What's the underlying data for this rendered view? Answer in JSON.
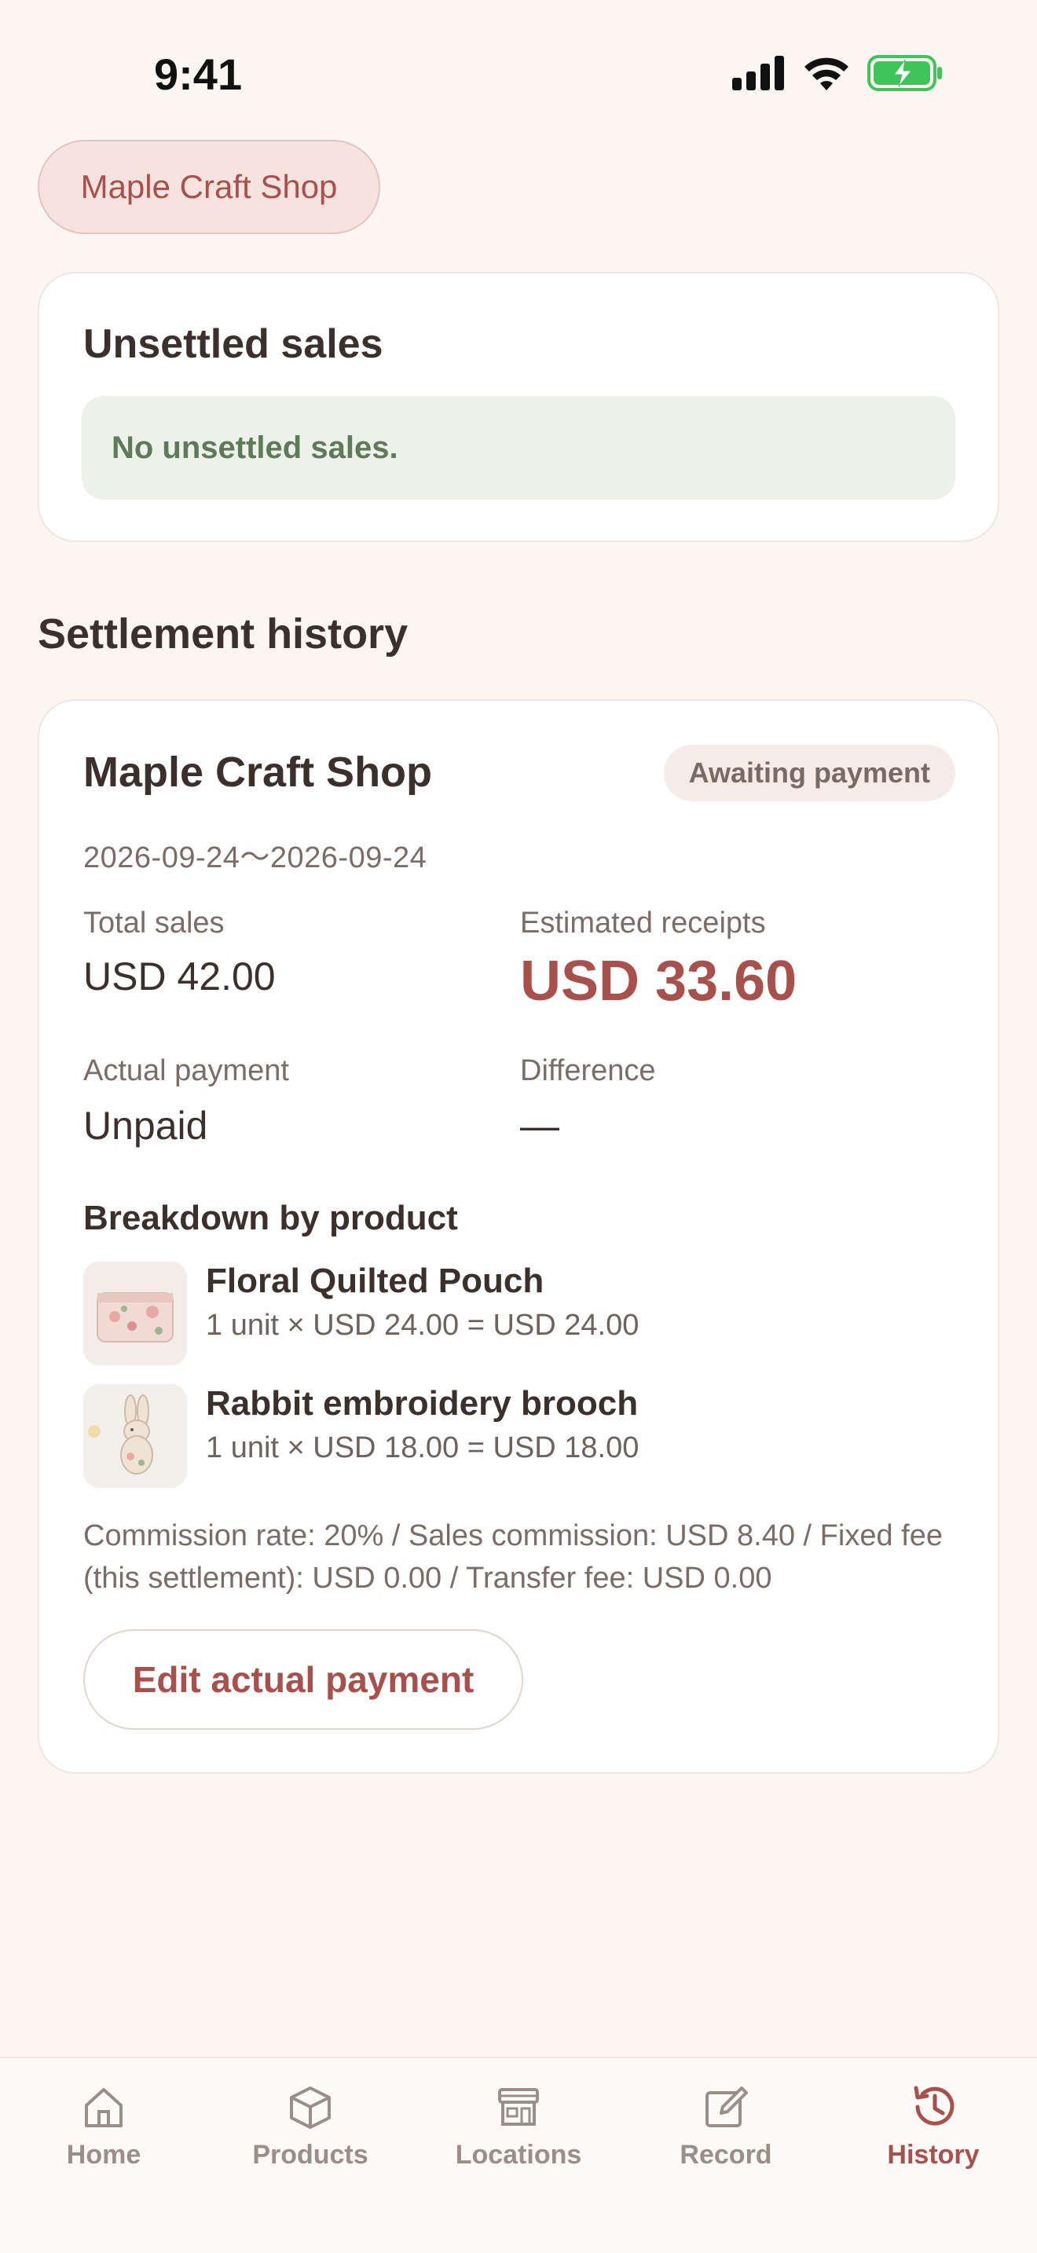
{
  "status_bar": {
    "time": "9:41",
    "icons": [
      "cellular-signal-icon",
      "wifi-icon",
      "battery-charging-icon"
    ]
  },
  "shop_filter": {
    "label": "Maple Craft Shop"
  },
  "unsettled": {
    "title": "Unsettled sales",
    "empty_message": "No unsettled sales."
  },
  "history": {
    "section_title": "Settlement history",
    "item": {
      "shop_name": "Maple Craft Shop",
      "status": "Awaiting payment",
      "period": "2026-09-24〜2026-09-24",
      "total_sales_label": "Total sales",
      "total_sales_value": "USD 42.00",
      "estimated_label": "Estimated receipts",
      "estimated_value": "USD 33.60",
      "actual_label": "Actual payment",
      "actual_value": "Unpaid",
      "difference_label": "Difference",
      "difference_value": "—",
      "breakdown_title": "Breakdown by product",
      "products": [
        {
          "name": "Floral Quilted Pouch",
          "detail": "1 unit × USD 24.00 = USD 24.00",
          "thumb": "floral-pouch-thumbnail"
        },
        {
          "name": "Rabbit embroidery brooch",
          "detail": "1 unit × USD 18.00 = USD 18.00",
          "thumb": "rabbit-brooch-thumbnail"
        }
      ],
      "commission_text": "Commission rate: 20% / Sales commission: USD 8.40 / Fixed fee (this settlement): USD 0.00 / Transfer fee: USD 0.00",
      "edit_button": "Edit actual payment"
    }
  },
  "tabs": [
    {
      "label": "Home",
      "icon": "home-icon",
      "active": false
    },
    {
      "label": "Products",
      "icon": "box-icon",
      "active": false
    },
    {
      "label": "Locations",
      "icon": "store-icon",
      "active": false
    },
    {
      "label": "Record",
      "icon": "edit-icon",
      "active": false
    },
    {
      "label": "History",
      "icon": "history-icon",
      "active": true
    }
  ],
  "colors": {
    "background": "#fcf6f2",
    "accent": "#a8504b",
    "chip_bg": "#f6e3e0",
    "empty_box_bg": "#eef1ea",
    "empty_box_text": "#5e7a58",
    "badge_bg": "#f6ebe7",
    "battery_green": "#3fc35a"
  }
}
